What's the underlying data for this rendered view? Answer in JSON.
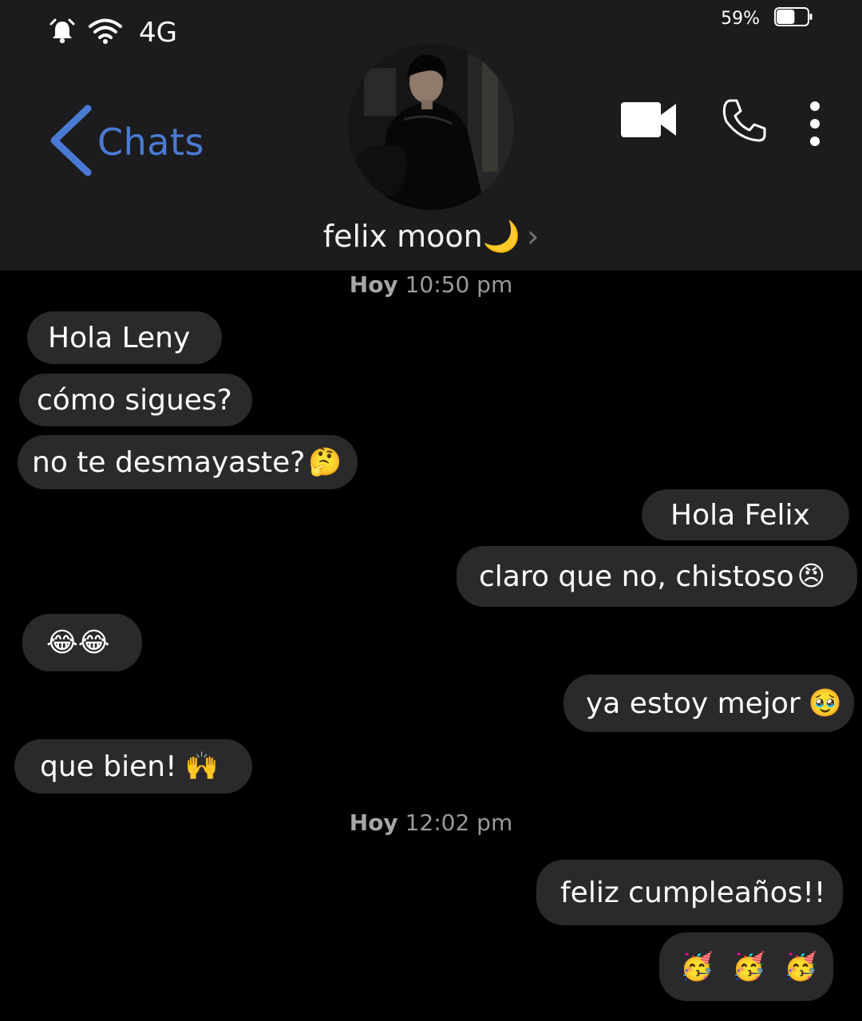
{
  "status_bar": {
    "network": "4G",
    "battery_percent": "59%",
    "battery_level": 0.59,
    "icons": [
      "alarm-icon",
      "wifi-icon"
    ]
  },
  "header": {
    "back_label": "Chats",
    "contact_name": "felix moon",
    "contact_emoji": "🌙",
    "chevron": "›",
    "actions": [
      "video-call-icon",
      "phone-icon",
      "more-vert-icon"
    ],
    "accent_color": "#4a7bd4"
  },
  "conversation": {
    "ts1": {
      "day": "Hoy",
      "time": "10:50 pm"
    },
    "ts2": {
      "day": "Hoy",
      "time": "12:02 pm"
    },
    "m1": {
      "text": "Hola Leny",
      "from": "them"
    },
    "m2": {
      "text": "cómo sigues?",
      "from": "them"
    },
    "m3": {
      "text": "no te desmayaste?",
      "emoji": "🤔",
      "from": "them"
    },
    "m4": {
      "text": "Hola Felix",
      "from": "me"
    },
    "m5": {
      "text": "claro que no, chistoso",
      "emoji": "😠",
      "from": "me"
    },
    "m6": {
      "emoji": "😂😂",
      "from": "them"
    },
    "m7": {
      "text": "ya estoy mejor",
      "emoji": "🥹",
      "from": "me"
    },
    "m8": {
      "text": "que bien!",
      "emoji": "🙌",
      "from": "them"
    },
    "m9": {
      "text": "feliz cumpleaños!!",
      "from": "me"
    },
    "m10": {
      "emoji": "🥳 🥳 🥳",
      "from": "me"
    }
  }
}
